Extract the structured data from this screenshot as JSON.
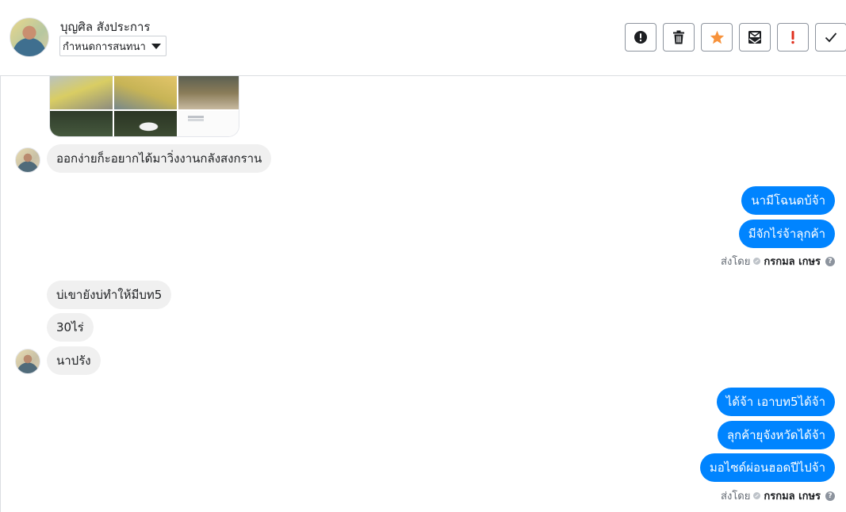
{
  "header": {
    "contact_name": "บุญศิล สังประการ",
    "assign_label": "กำหนดการสนทนา",
    "avatar_icon": "contact-avatar",
    "toolbar": [
      {
        "name": "spam-button",
        "icon": "exclamation-circle-icon"
      },
      {
        "name": "delete-button",
        "icon": "trash-icon"
      },
      {
        "name": "star-button",
        "icon": "star-icon",
        "color": "#f7923b"
      },
      {
        "name": "archive-button",
        "icon": "archive-mail-icon"
      },
      {
        "name": "follow-up-button",
        "icon": "exclamation-mark-icon",
        "color": "#e0301e"
      },
      {
        "name": "done-button",
        "icon": "checkmark-icon"
      }
    ]
  },
  "messages": {
    "incoming_1": "ออกง่ายก็ะอยากได้มาวิ่งงานกลังสงกราน",
    "outgoing_1": "นามีโฉนดบ้จ้า",
    "outgoing_2": "มีจักไร่จ้าลุกค้า",
    "incoming_2": "บ่เขายังบ่ทำให้มีบท5",
    "incoming_3": "30ไร่",
    "incoming_4": "นาปรัง",
    "outgoing_3": "ได้จ้า เอาบท5ได้จ้า",
    "outgoing_4": "ลุกค้ายุจังหวัดได้จ้า",
    "outgoing_5": "มอไซด์ผ่อนฮอดปีไปจ้า"
  },
  "sent_by": {
    "prefix": "ส่งโดย",
    "agent_name": "กรกมล เกษร",
    "help_glyph": "?"
  },
  "colors": {
    "outgoing_bubble": "#0084ff",
    "incoming_bubble": "#f0f0f0",
    "star": "#f7923b",
    "alert": "#e0301e"
  }
}
